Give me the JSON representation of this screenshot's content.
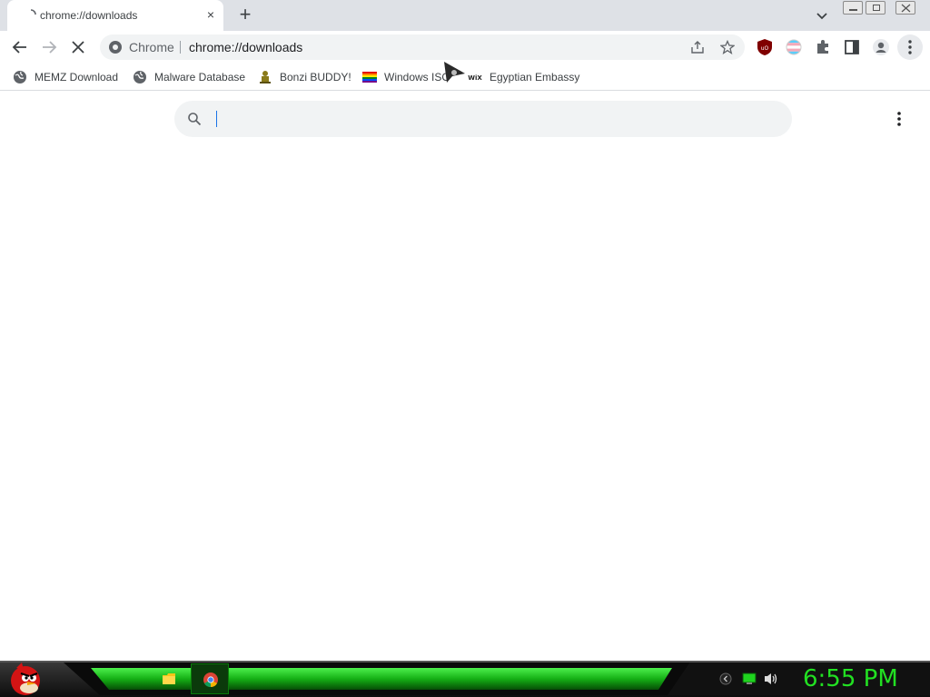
{
  "tab": {
    "title": "chrome://downloads",
    "close_glyph": "×",
    "loading_icon": "loading-spinner-icon"
  },
  "newtab": {
    "glyph": "+"
  },
  "omnibox": {
    "chip": "Chrome",
    "url": "chrome://downloads"
  },
  "bookmarks": [
    {
      "label": "MEMZ Download",
      "icon": "globe-icon"
    },
    {
      "label": "Malware Database",
      "icon": "globe-icon"
    },
    {
      "label": "Bonzi BUDDY!",
      "icon": "bonzi-icon"
    },
    {
      "label": "Windows ISO",
      "icon": "windows-flag-icon"
    },
    {
      "label": "Egyptian Embassy",
      "icon": "wix-icon"
    }
  ],
  "downloads": {
    "search_value": "",
    "search_placeholder": ""
  },
  "taskbar": {
    "clock": "6:55 PM"
  },
  "colors": {
    "tabstrip": "#dee1e6",
    "omnibox": "#f1f3f4",
    "clock": "#22e022",
    "taskbar_green": "#21d021"
  }
}
